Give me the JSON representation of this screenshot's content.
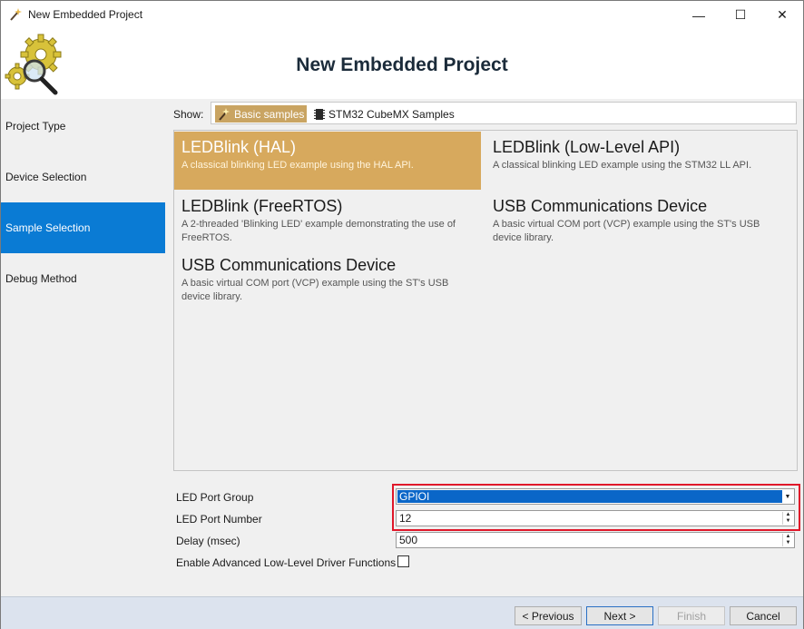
{
  "window": {
    "title": "New Embedded Project",
    "minimize_glyph": "—",
    "maximize_glyph": "☐",
    "close_glyph": "✕"
  },
  "header": {
    "heading": "New Embedded Project"
  },
  "sidebar": {
    "items": [
      {
        "label": "Project Type",
        "active": false
      },
      {
        "label": "Device Selection",
        "active": false
      },
      {
        "label": "Sample Selection",
        "active": true
      },
      {
        "label": "Debug Method",
        "active": false
      }
    ]
  },
  "show": {
    "label": "Show:",
    "options": [
      {
        "label": "Basic samples",
        "icon": "wand-icon",
        "selected": true
      },
      {
        "label": "STM32 CubeMX Samples",
        "icon": "chip-icon",
        "selected": false
      }
    ]
  },
  "samples": [
    {
      "title": "LEDBlink (HAL)",
      "desc": "A classical blinking LED example using the HAL API.",
      "selected": true
    },
    {
      "title": "LEDBlink (Low-Level API)",
      "desc": "A classical blinking LED example using the STM32 LL API.",
      "selected": false
    },
    {
      "title": "LEDBlink (FreeRTOS)",
      "desc": "A 2-threaded 'Blinking LED' example demonstrating the use of FreeRTOS.",
      "selected": false
    },
    {
      "title": "USB Communications Device",
      "desc": "A basic virtual COM port (VCP) example using the ST's USB device library.",
      "selected": false
    },
    {
      "title": "USB Communications Device",
      "desc": "A basic virtual COM port (VCP) example using the ST's USB device library.",
      "selected": false
    }
  ],
  "properties": {
    "led_port_group": {
      "label": "LED Port Group",
      "value": "GPIOI"
    },
    "led_port_number": {
      "label": "LED Port Number",
      "value": "12"
    },
    "delay": {
      "label": "Delay (msec)",
      "value": "500"
    },
    "enable_ll": {
      "label": "Enable Advanced Low-Level Driver Functions",
      "checked": false
    }
  },
  "footer": {
    "previous": "< Previous",
    "next": "Next >",
    "finish": "Finish",
    "cancel": "Cancel"
  },
  "colors": {
    "accent_blue": "#0a7bd4",
    "selected_sample": "#d7a95d",
    "highlight_red": "#e0182a"
  }
}
